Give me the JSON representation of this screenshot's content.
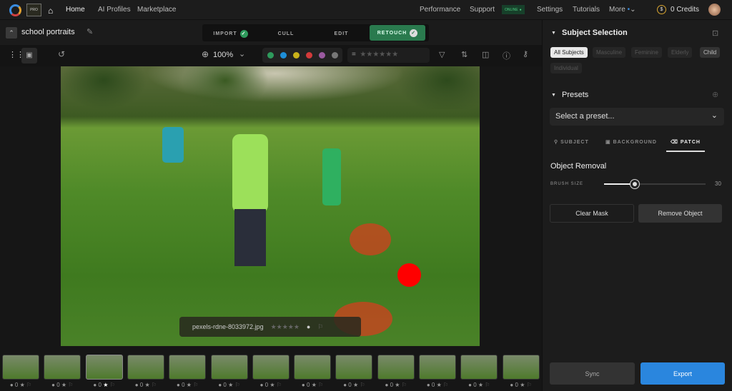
{
  "topbar": {
    "pro": "PRO",
    "home": "Home",
    "ai_profiles": "AI Profiles",
    "marketplace": "Marketplace",
    "performance": "Performance",
    "support": "Support",
    "online": "ONLINE",
    "settings": "Settings",
    "tutorials": "Tutorials",
    "more": "More",
    "credits": "0 Credits"
  },
  "project": {
    "title": "school portraits"
  },
  "steps": [
    {
      "label": "IMPORT",
      "done": true
    },
    {
      "label": "CULL",
      "done": false
    },
    {
      "label": "EDIT",
      "done": false
    },
    {
      "label": "RETOUCH",
      "done": true,
      "active": true
    }
  ],
  "toolbar": {
    "zoom": "100%",
    "color_labels": [
      "#2e9a5c",
      "#1e8fd8",
      "#c9b21a",
      "#d33a3a",
      "#9b5aa0",
      "#777777"
    ],
    "equals": "="
  },
  "image": {
    "filename": "pexels-rdne-8033972.jpg"
  },
  "panel": {
    "subject_title": "Subject Selection",
    "chips": [
      {
        "label": "All Subjects",
        "state": "selected"
      },
      {
        "label": "Masculine",
        "state": "disabled"
      },
      {
        "label": "Feminine",
        "state": "disabled"
      },
      {
        "label": "Elderly",
        "state": "disabled"
      },
      {
        "label": "Child",
        "state": "enabled"
      },
      {
        "label": "Individual",
        "state": "disabled"
      }
    ],
    "presets_title": "Presets",
    "preset_placeholder": "Select a preset...",
    "tabs": [
      {
        "label": "SUBJECT"
      },
      {
        "label": "BACKGROUND"
      },
      {
        "label": "PATCH",
        "active": true
      }
    ],
    "object_removal": "Object Removal",
    "brush_label": "BRUSH SIZE",
    "brush_value": "30",
    "brush_fraction": 0.3,
    "clear_mask": "Clear Mask",
    "remove_object": "Remove Object",
    "sync": "Sync",
    "export": "Export"
  },
  "filmstrip": [
    {
      "count": "0"
    },
    {
      "count": "0"
    },
    {
      "count": "0",
      "selected": true
    },
    {
      "count": "0"
    },
    {
      "count": "0"
    },
    {
      "count": "0"
    },
    {
      "count": "0"
    },
    {
      "count": "0"
    },
    {
      "count": "0"
    },
    {
      "count": "0"
    },
    {
      "count": "0"
    },
    {
      "count": "0"
    },
    {
      "count": "0"
    }
  ]
}
